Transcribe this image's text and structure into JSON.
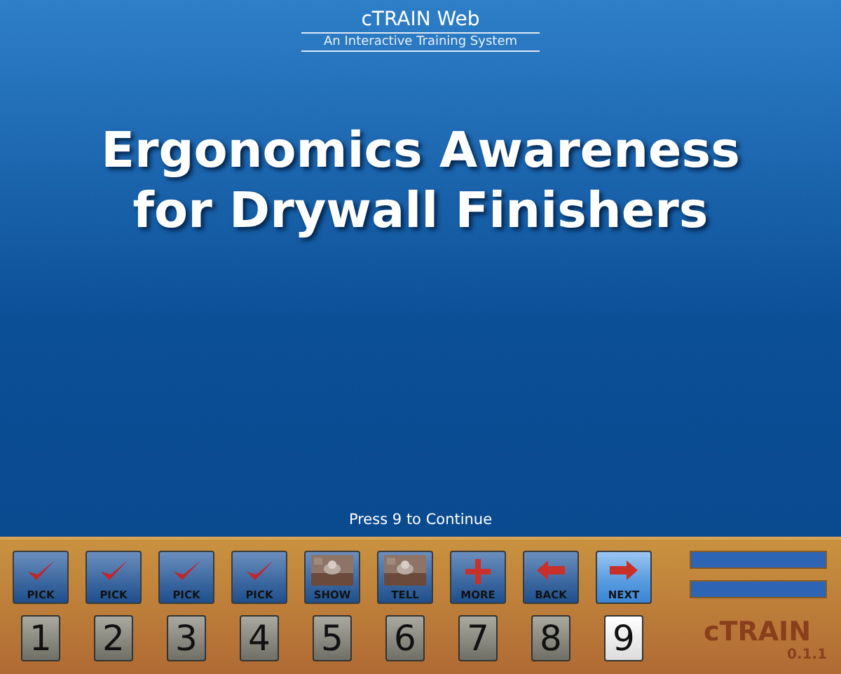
{
  "header": {
    "title": "cTRAIN Web",
    "subtitle": "An Interactive Training System"
  },
  "slide": {
    "title_lines": [
      "Ergonomics Awareness",
      "for Drywall Finishers"
    ]
  },
  "prompt": "Press 9 to Continue",
  "controls": [
    {
      "kind": "check",
      "label": "PICK",
      "key": "1",
      "selected": false
    },
    {
      "kind": "check",
      "label": "PICK",
      "key": "2",
      "selected": false
    },
    {
      "kind": "check",
      "label": "PICK",
      "key": "3",
      "selected": false
    },
    {
      "kind": "check",
      "label": "PICK",
      "key": "4",
      "selected": false
    },
    {
      "label": "SHOW",
      "key": "5",
      "selected": false
    },
    {
      "label": "TELL",
      "key": "6",
      "selected": false
    },
    {
      "kind": "plus",
      "label": "MORE",
      "key": "7",
      "selected": false
    },
    {
      "kind": "back",
      "label": "BACK",
      "key": "8",
      "selected": false
    },
    {
      "kind": "next",
      "label": "NEXT",
      "key": "9",
      "selected": true
    }
  ],
  "brand": {
    "logo": "cTRAIN",
    "version": "0.1.1"
  }
}
